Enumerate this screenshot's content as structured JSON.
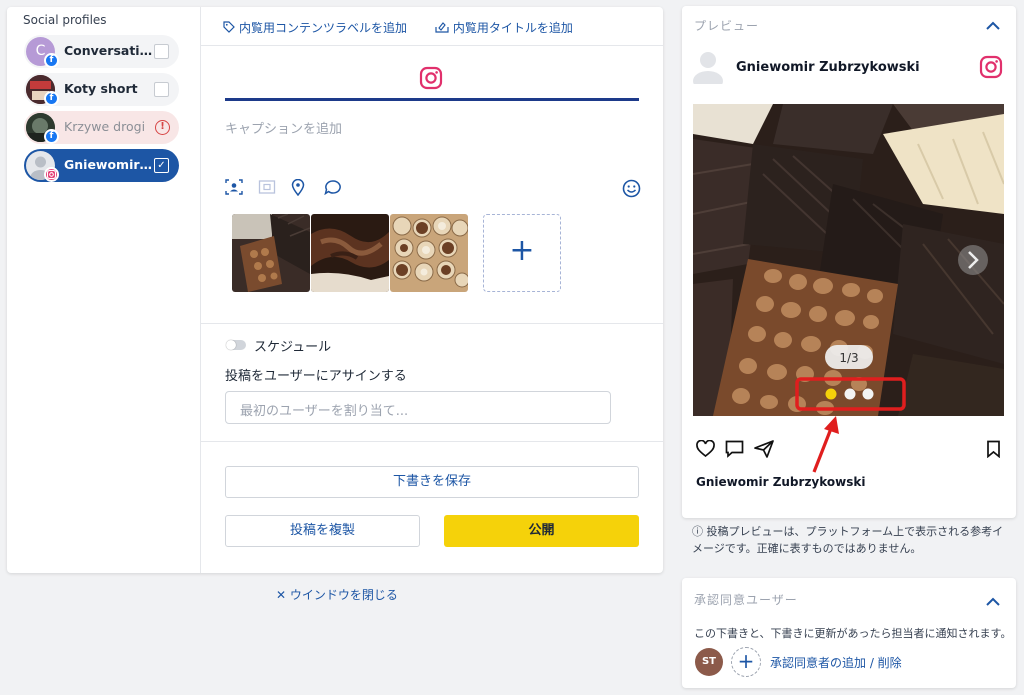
{
  "sidebar": {
    "title": "Social profiles",
    "profiles": [
      {
        "name": "Conversation ...",
        "network": "facebook",
        "status": "unchecked",
        "avatar_letter": "C"
      },
      {
        "name": "Koty short",
        "network": "facebook",
        "status": "unchecked"
      },
      {
        "name": "Krzywe drogi",
        "network": "facebook",
        "status": "error",
        "error_icon": "!"
      },
      {
        "name": "Gniewomir Zu...",
        "network": "instagram",
        "status": "checked",
        "check_icon": "✓"
      }
    ]
  },
  "editor": {
    "links": {
      "content_label": "内覧用コンテンツラベルを追加",
      "internal_title": "内覧用タイトルを追加"
    },
    "caption_placeholder": "キャプションを追加",
    "add_media_icon": "+",
    "schedule_label": "スケジュール",
    "assign_label": "投稿をユーザーにアサインする",
    "assign_placeholder": "最初のユーザーを割り当て...",
    "save_draft": "下書きを保存",
    "duplicate": "投稿を複製",
    "publish": "公開"
  },
  "close_window": "ウインドウを閉じる",
  "close_icon": "✕",
  "preview": {
    "title": "プレビュー",
    "author": "Gniewomir Zubrzykowski",
    "counter": "1/3",
    "name_line": "Gniewomir Zubrzykowski",
    "note_icon": "ⓘ",
    "note": "投稿プレビューは、プラットフォーム上で表示される参考イメージです。正確に表すものではありません。"
  },
  "approvers": {
    "title": "承認同意ユーザー",
    "description": "この下書きと、下書きに更新があったら担当者に通知されます。",
    "user_initials": "ST",
    "add_icon": "+",
    "link": "承認同意者の追加 / 削除"
  },
  "colors": {
    "accent": "#1d56a5",
    "publish": "#f5d20a",
    "instagram": "#e1306c",
    "annotation": "#e01e1e"
  }
}
